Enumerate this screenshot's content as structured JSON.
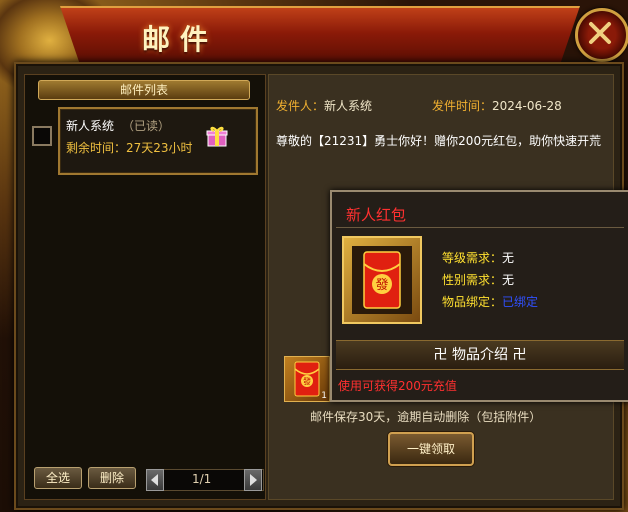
{
  "window": {
    "title": "邮件"
  },
  "mail_list": {
    "header": "邮件列表",
    "items": [
      {
        "sender": "新人系统",
        "status": "（已读）",
        "remaining": "剩余时间：27天23小时"
      }
    ]
  },
  "footer": {
    "select_all": "全选",
    "delete": "删除",
    "page": "1/1"
  },
  "mail_detail": {
    "sender_label": "发件人：",
    "sender": "新人系统",
    "time_label": "发件时间：",
    "time": "2024-06-28",
    "body": "尊敬的【21231】勇士你好！赠你200元红包，助你快速开荒",
    "attachment_count": "1",
    "keep_note": "邮件保存30天，逾期自动删除（包括附件）",
    "claim_button": "一键领取"
  },
  "tooltip": {
    "name": "新人红包",
    "level_label": "等级需求：",
    "level_value": "无",
    "gender_label": "性别需求：",
    "gender_value": "无",
    "bind_label": "物品绑定：",
    "bind_value": "已绑定",
    "intro_header": "卍 物品介绍 卍",
    "description": "使用可获得200元充值"
  },
  "icons": [
    "dragon-ornament",
    "close-icon",
    "gift-icon",
    "red-envelope-icon",
    "arrow-left-icon",
    "arrow-right-icon"
  ],
  "colors": {
    "title_red": "#8a1a08",
    "gold": "#f0b030",
    "tooltip_title": "#ff3030",
    "bound_blue": "#3050ff"
  }
}
